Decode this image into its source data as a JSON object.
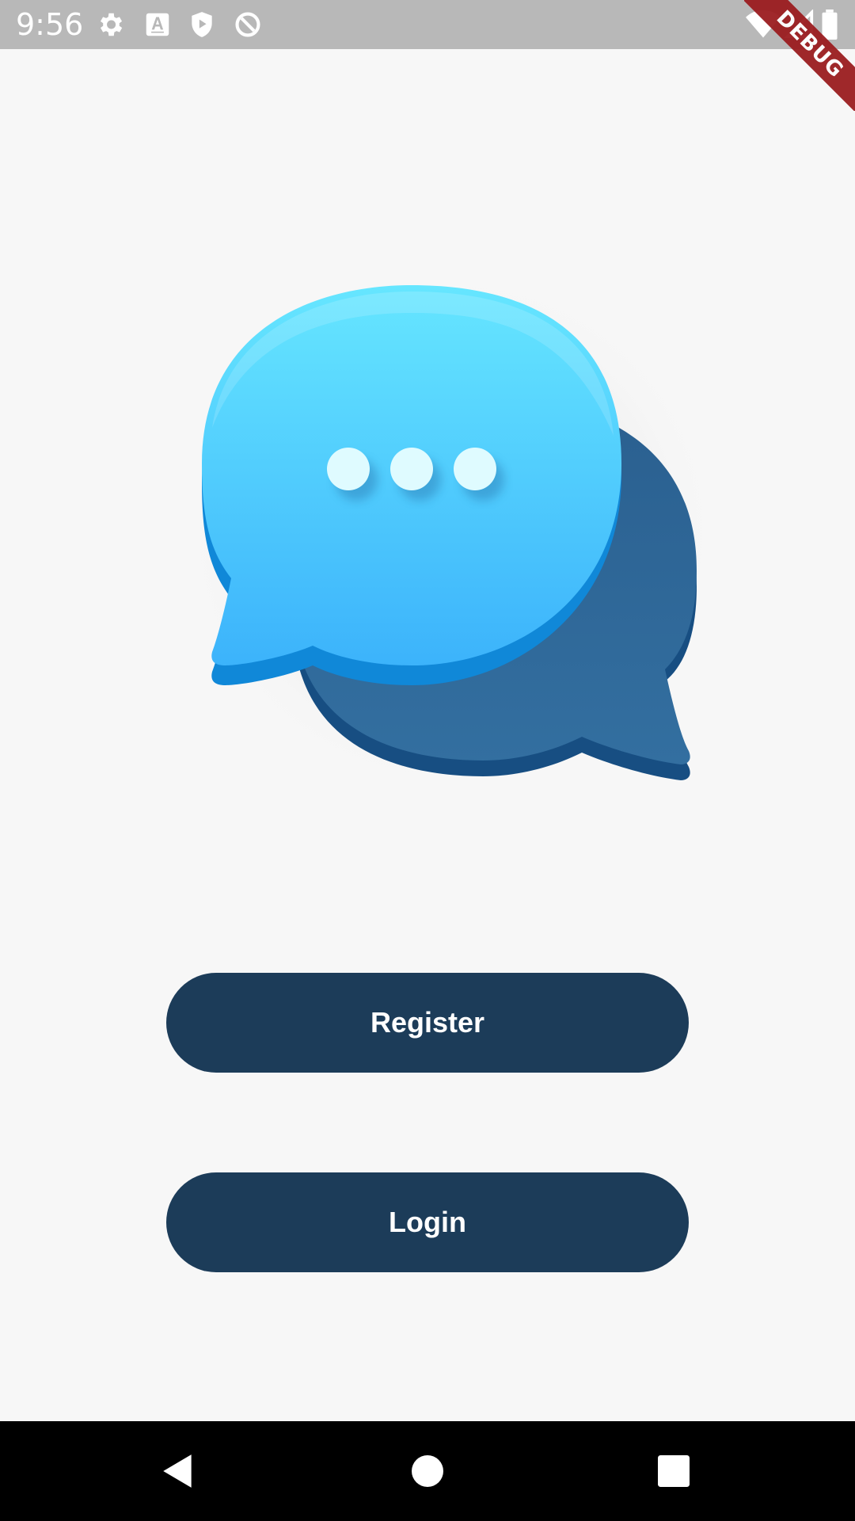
{
  "status_bar": {
    "time": "9:56",
    "debug_label": "DEBUG",
    "icons_left": [
      "gear-icon",
      "font-download-icon",
      "play-protect-icon",
      "data-saver-icon"
    ],
    "icons_right": [
      "wifi-icon",
      "cellular-signal-icon",
      "battery-icon"
    ]
  },
  "logo": {
    "icon": "chat-bubbles-icon",
    "front_bubble_color": "#3fb8fb",
    "back_bubble_color": "#2c6a9e"
  },
  "actions": {
    "register_label": "Register",
    "login_label": "Login",
    "button_color": "#1c3c59"
  },
  "nav_bar": {
    "icons": [
      "back-icon",
      "home-icon",
      "recents-icon"
    ]
  },
  "colors": {
    "background": "#f7f7f7",
    "status_bar": "#b8b8b8",
    "debug_banner": "#9b1d20"
  }
}
